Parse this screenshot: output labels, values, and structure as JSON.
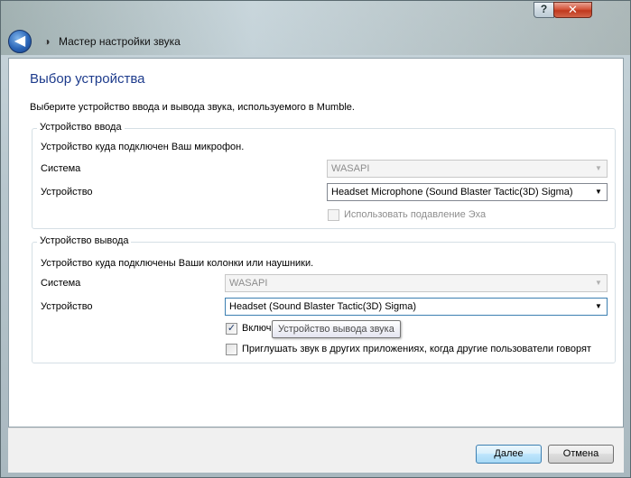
{
  "window": {
    "title": "Мастер настройки звука",
    "help_label": "?",
    "close_label": "✕"
  },
  "page": {
    "heading": "Выбор устройства",
    "description": "Выберите устройство ввода и вывода звука, используемого в Mumble."
  },
  "input_group": {
    "legend": "Устройство ввода",
    "description": "Устройство куда подключен Ваш микрофон.",
    "system_label": "Система",
    "system_value": "WASAPI",
    "device_label": "Устройство",
    "device_value": "Headset Microphone (Sound Blaster Tactic(3D) Sigma)",
    "echo_label": "Использовать подавление Эха",
    "echo_checked": false
  },
  "output_group": {
    "legend": "Устройство вывода",
    "description": "Устройство куда подключены Ваши колонки или наушники.",
    "system_label": "Система",
    "system_value": "WASAPI",
    "device_label": "Устройство",
    "device_value": "Headset (Sound Blaster Tactic(3D) Sigma)",
    "positional_label": "Включи",
    "positional_checked": true,
    "attenuate_label": "Приглушать звук в других приложениях, когда другие пользователи говорят",
    "attenuate_checked": false
  },
  "tooltip": "Устройство вывода звука",
  "footer": {
    "next_label": "Далее",
    "cancel_label": "Отмена"
  },
  "icons": {
    "back": "back-arrow-icon",
    "app": "mumble-icon",
    "dropdown": "chevron-down-icon",
    "check": "checkmark-icon"
  }
}
